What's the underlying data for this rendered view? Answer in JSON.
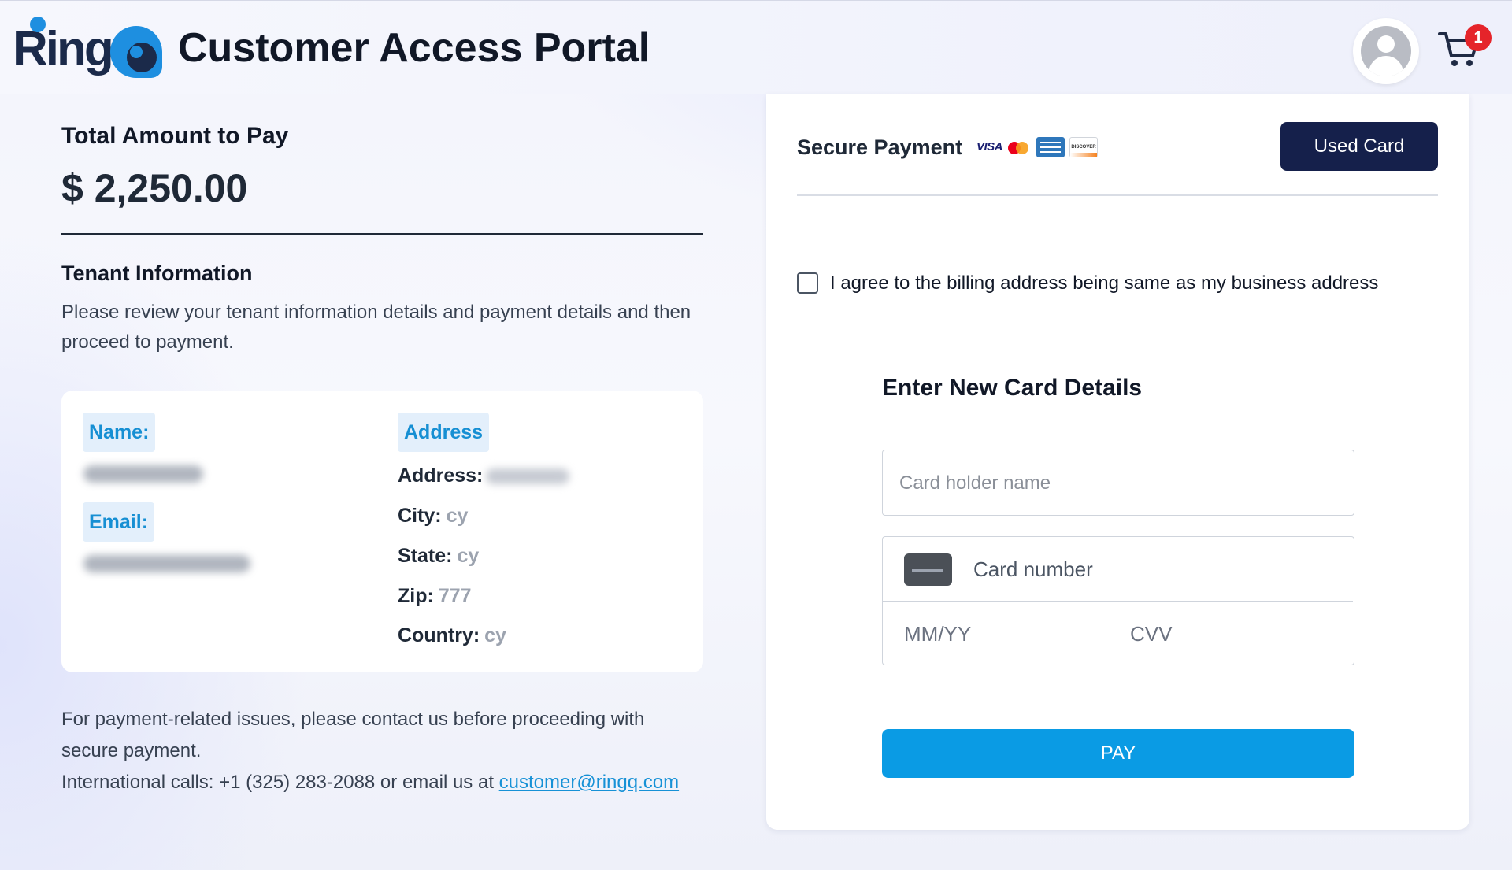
{
  "header": {
    "logo_text": "Ring",
    "title": "Customer Access Portal",
    "cart_count": "1",
    "icons": {
      "avatar": "user-avatar-icon",
      "cart": "shopping-cart-icon"
    }
  },
  "summary": {
    "total_label": "Total Amount to Pay",
    "total_amount": "$ 2,250.00"
  },
  "tenant": {
    "title": "Tenant Information",
    "description": "Please review your tenant information details and payment details and then proceed to payment.",
    "name_tag": "Name:",
    "email_tag": "Email:",
    "address_tag": "Address",
    "address_label": "Address:",
    "city_label": "City:",
    "city_value": "cy",
    "state_label": "State:",
    "state_value": "cy",
    "zip_label": "Zip:",
    "zip_value": "777",
    "country_label": "Country:",
    "country_value": "cy"
  },
  "contact": {
    "line1": "For payment-related issues, please contact us before proceeding with secure payment.",
    "line2_prefix": "International calls: +1 (325) 283-2088 or email us at ",
    "email": "customer@ringq.com"
  },
  "payment": {
    "secure_title": "Secure Payment",
    "brands": {
      "visa": "VISA",
      "discover": "DISCOVER"
    },
    "used_card_label": "Used Card",
    "agree_text": "I agree to the billing address being same as my business address",
    "agree_checked": false,
    "new_card_title": "Enter New Card Details",
    "cardholder_placeholder": "Card holder name",
    "card_number_placeholder": "Card number",
    "expiry_placeholder": "MM/YY",
    "cvv_placeholder": "CVV",
    "pay_label": "PAY"
  },
  "colors": {
    "primary_dark": "#15204b",
    "pay_blue": "#0a9be4",
    "tag_blue": "#168fd3",
    "badge_red": "#e5242a"
  }
}
